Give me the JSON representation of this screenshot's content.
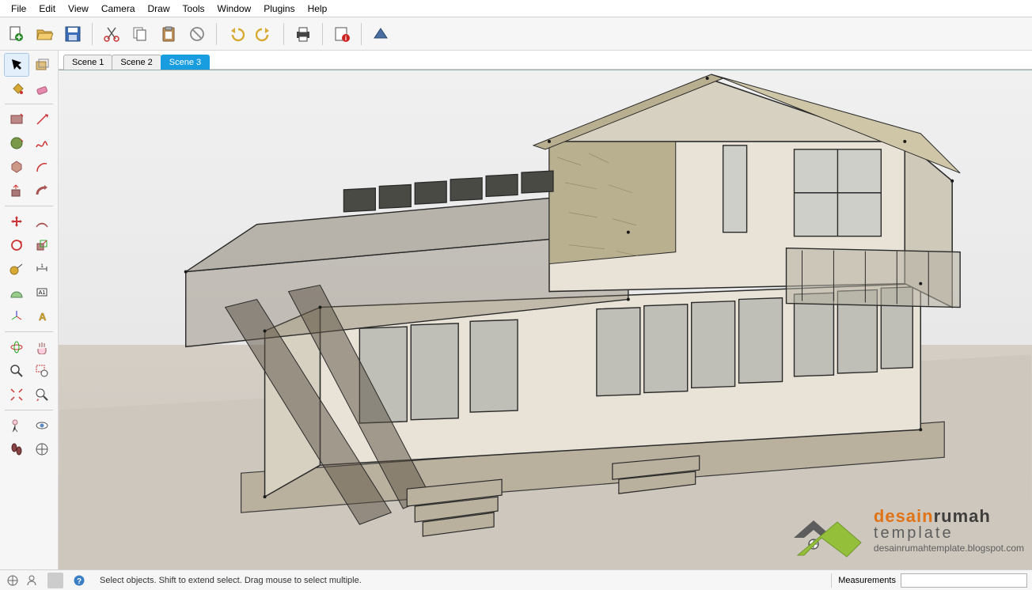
{
  "menu": {
    "items": [
      "File",
      "Edit",
      "View",
      "Camera",
      "Draw",
      "Tools",
      "Window",
      "Plugins",
      "Help"
    ]
  },
  "scene_tabs": [
    {
      "label": "Scene 1",
      "active": false
    },
    {
      "label": "Scene 2",
      "active": false
    },
    {
      "label": "Scene 3",
      "active": true
    }
  ],
  "status": {
    "hint": "Select objects. Shift to extend select. Drag mouse to select multiple.",
    "measurements_label": "Measurements",
    "measurements_value": ""
  },
  "watermark": {
    "brand_a": "desain",
    "brand_b": "rumah",
    "line2": "template",
    "url": "desainrumahtemplate.blogspot.com"
  },
  "toolbar_icons": {
    "new": "new-file-icon",
    "open": "open-file-icon",
    "save": "save-icon",
    "cut": "cut-icon",
    "copy": "copy-icon",
    "paste": "paste-icon",
    "erase": "erase-icon",
    "undo": "undo-icon",
    "redo": "redo-icon",
    "print": "print-icon",
    "model_info": "model-info-icon",
    "styles": "styles-icon"
  }
}
